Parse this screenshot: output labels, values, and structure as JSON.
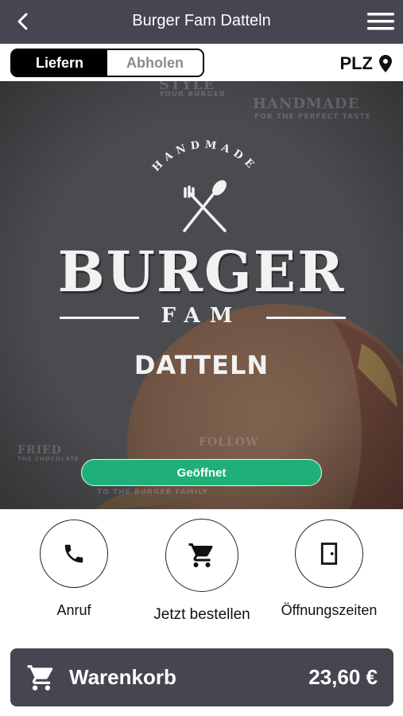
{
  "header": {
    "title": "Burger Fam Datteln",
    "back_icon": "chevron-left-icon",
    "menu_icon": "hamburger-menu-icon",
    "background_color": "#454650"
  },
  "mode_toggle": {
    "options": [
      "Liefern",
      "Abholen"
    ],
    "selected": "Liefern"
  },
  "plz": {
    "label": "PLZ",
    "icon": "location-pin-icon"
  },
  "hero": {
    "background_texts": {
      "style_top": "STYLE",
      "style_sub": "YOUR BURGER",
      "handmade_top": "HANDMADE",
      "handmade_sub": "FOR THE PERFECT TASTE",
      "fried": "FRIED",
      "fried_sub": "THE CHOCOLATE",
      "follow": "FOLLOW",
      "family": "TO THE BURGER FAMILY"
    },
    "logo": {
      "arc_text": "HANDMADE",
      "name": "BURGER",
      "sub": "FAM",
      "city": "DATTELN"
    },
    "status": "Geöffnet",
    "status_color": "#1fb07a"
  },
  "actions": [
    {
      "label": "Anruf",
      "icon": "phone-icon"
    },
    {
      "label": "Jetzt bestellen",
      "icon": "shopping-cart-icon"
    },
    {
      "label": "Öffnungszeiten",
      "icon": "door-icon"
    }
  ],
  "cart": {
    "label": "Warenkorb",
    "total": "23,60 €",
    "icon": "shopping-cart-icon"
  }
}
